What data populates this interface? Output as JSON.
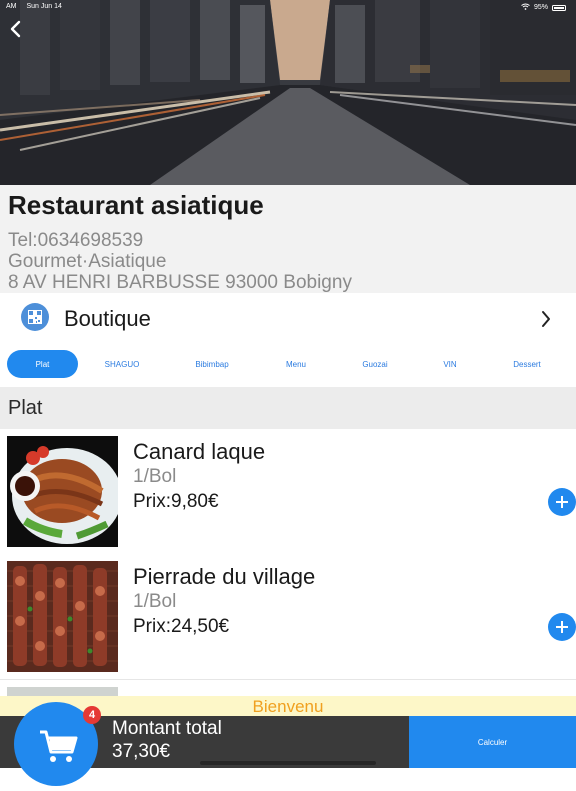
{
  "status_bar": {
    "time": "AM",
    "date": "Sun Jun 14",
    "battery": "95%"
  },
  "restaurant": {
    "name": "Restaurant asiatique",
    "tel": "Tel:0634698539",
    "category": "Gourmet·Asiatique",
    "address": "8 AV HENRI BARBUSSE 93000 Bobigny"
  },
  "boutique": {
    "label": "Boutique"
  },
  "tabs": [
    {
      "label": "Plat",
      "active": true
    },
    {
      "label": "SHAGUO"
    },
    {
      "label": "Bibimbap"
    },
    {
      "label": "Menu"
    },
    {
      "label": "Guozai"
    },
    {
      "label": "VIN"
    },
    {
      "label": "Dessert"
    }
  ],
  "section": {
    "title": "Plat"
  },
  "items": [
    {
      "name": "Canard laque",
      "unit": "1/Bol",
      "price": "Prix:9,80€"
    },
    {
      "name": "Pierrade du village",
      "unit": "1/Bol",
      "price": "Prix:24,50€"
    }
  ],
  "banner": {
    "text": "Bienvenu"
  },
  "cart": {
    "badge_count": "4",
    "total_label": "Montant total",
    "total_value": "37,30€",
    "checkout_label": "Calculer"
  },
  "icons": {
    "back": "chevron-left-icon",
    "boutique": "qr-code-icon",
    "boutique_chevron": "chevron-right-icon",
    "add": "plus-icon",
    "cart": "shopping-cart-icon"
  },
  "colors": {
    "accent": "#2189ee",
    "badge": "#e53935",
    "banner_bg": "#fdf7c8",
    "banner_text": "#f0a020",
    "bottom_bar": "#3a3a3a"
  }
}
